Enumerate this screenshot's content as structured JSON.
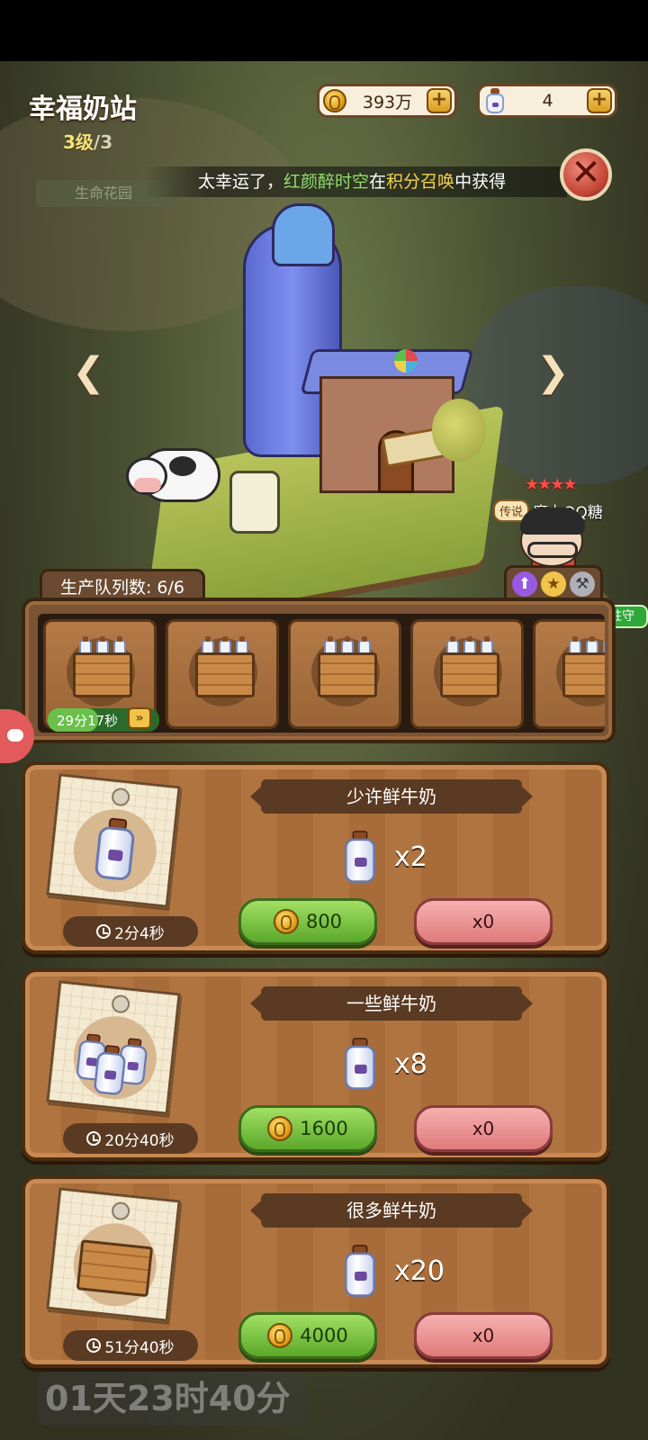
{
  "header": {
    "title": "幸福奶站",
    "level_current": "3级",
    "level_max": "/3",
    "garden_label": "生命花园"
  },
  "resources": {
    "coins": "393万",
    "milk": "4"
  },
  "ticker": {
    "prefix": "太幸运了，",
    "player": "红颜醉时空",
    "middle": "在",
    "event": "积分召唤",
    "suffix": "中获得"
  },
  "hero": {
    "stars": "★★★★",
    "rarity": "传说",
    "name": "魔力QQ糖",
    "garrison_label": "驻守"
  },
  "queue": {
    "label": "生产队列数: 6/6",
    "active_timer": "29分17秒",
    "active_progress": 0.45,
    "slots": 5,
    "speed_icon": "»"
  },
  "recipes": [
    {
      "name": "少许鲜牛奶",
      "yield": "x2",
      "time": "2分4秒",
      "cost": "800",
      "count": "x0",
      "icon": "single-bottle"
    },
    {
      "name": "一些鲜牛奶",
      "yield": "x8",
      "time": "20分40秒",
      "cost": "1600",
      "count": "x0",
      "icon": "bottle-group"
    },
    {
      "name": "很多鲜牛奶",
      "yield": "x20",
      "time": "51分40秒",
      "cost": "4000",
      "count": "x0",
      "icon": "bottle-crate"
    }
  ],
  "footer": {
    "countdown": "01天23时40分"
  },
  "icons": {
    "close": "✕",
    "left": "❮",
    "right": "❯",
    "plus": "+"
  }
}
